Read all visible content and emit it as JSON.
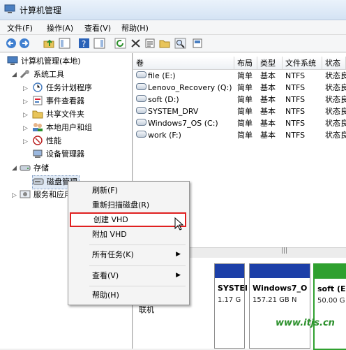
{
  "window": {
    "title": "计算机管理"
  },
  "menu": [
    "文件(F)",
    "操作(A)",
    "查看(V)",
    "帮助(H)"
  ],
  "toolbar_icons": [
    "back-icon",
    "forward-icon",
    "up-folder-icon",
    "show-tree-icon",
    "help-icon",
    "show-pane-icon",
    "refresh-icon",
    "delete-icon",
    "properties-icon",
    "open-folder-icon",
    "search-icon",
    "export-icon"
  ],
  "tree": {
    "root": "计算机管理(本地)",
    "system_tools": "系统工具",
    "task_scheduler": "任务计划程序",
    "event_viewer": "事件查看器",
    "shared_folders": "共享文件夹",
    "local_users": "本地用户和组",
    "performance": "性能",
    "device_manager": "设备管理器",
    "storage": "存储",
    "disk_management": "磁盘管理",
    "services": "服务和应用"
  },
  "table": {
    "headers": [
      "卷",
      "布局",
      "类型",
      "文件系统",
      "状态"
    ],
    "rows": [
      [
        "file (E:)",
        "简单",
        "基本",
        "NTFS",
        "状态良"
      ],
      [
        "Lenovo_Recovery (Q:)",
        "简单",
        "基本",
        "NTFS",
        "状态良"
      ],
      [
        "soft (D:)",
        "简单",
        "基本",
        "NTFS",
        "状态良"
      ],
      [
        "SYSTEM_DRV",
        "简单",
        "基本",
        "NTFS",
        "状态良"
      ],
      [
        "Windows7_OS (C:)",
        "简单",
        "基本",
        "NTFS",
        "状态良"
      ],
      [
        "work (F:)",
        "简单",
        "基本",
        "NTFS",
        "状态良"
      ]
    ]
  },
  "splitter": {
    "grip": "|||"
  },
  "graph": {
    "online": "联机",
    "partitions": [
      {
        "name": "SYSTEI",
        "size": "1.17 G"
      },
      {
        "name": "Windows7_O",
        "size": "157.21 GB N"
      },
      {
        "name": "soft  (E",
        "size": "50.00 G"
      }
    ]
  },
  "context_menu": {
    "refresh": "刷新(F)",
    "rescan": "重新扫描磁盘(R)",
    "create_vhd": "创建 VHD",
    "attach_vhd": "附加 VHD",
    "all_tasks": "所有任务(K)",
    "view": "查看(V)",
    "help": "帮助(H)"
  },
  "watermark": "www.itjs.cn",
  "colors": {
    "highlight_box": "#e02020",
    "partition_bar": "#1c3fa8",
    "partition_active": "#2fa02f"
  }
}
